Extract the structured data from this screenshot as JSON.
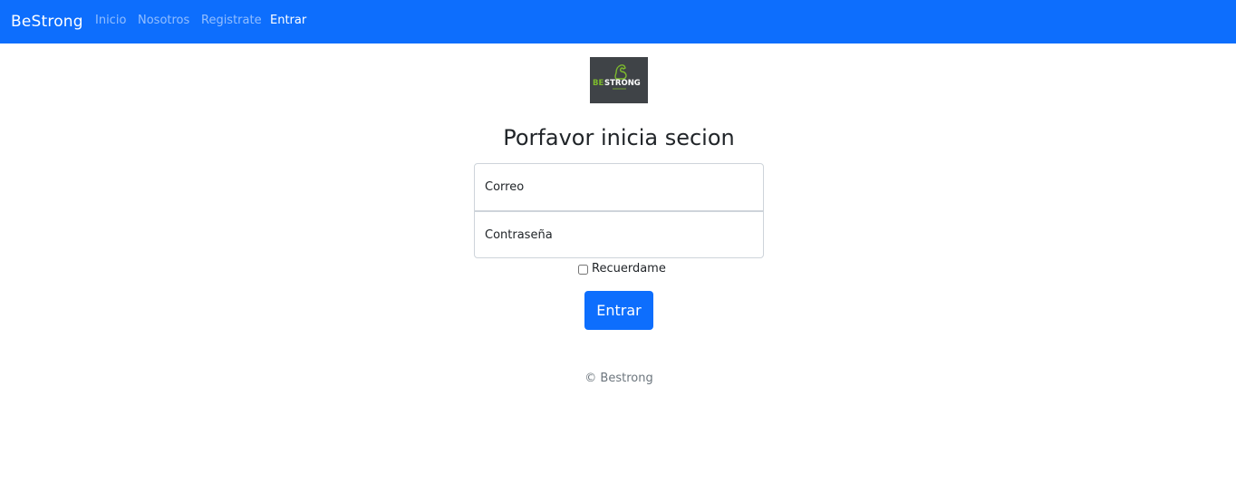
{
  "navbar": {
    "brand": "BeStrong",
    "links": [
      {
        "label": "Inicio",
        "active": false
      },
      {
        "label": "Nosotros",
        "active": false
      },
      {
        "label": "Registrate",
        "active": false
      },
      {
        "label": "Entrar",
        "active": true
      }
    ],
    "color": "#0d6efd"
  },
  "logo": {
    "icon": "bestrong-logo",
    "text_be": "BE",
    "text_strong": "STRONG",
    "accent_color": "#7dbb2d"
  },
  "form": {
    "heading": "Porfavor inicia secion",
    "email_placeholder": "Correo",
    "password_placeholder": "Contraseña",
    "remember_label": "Recuerdame",
    "remember_checked": false,
    "submit_label": "Entrar"
  },
  "footer": {
    "text": "© Bestrong"
  }
}
